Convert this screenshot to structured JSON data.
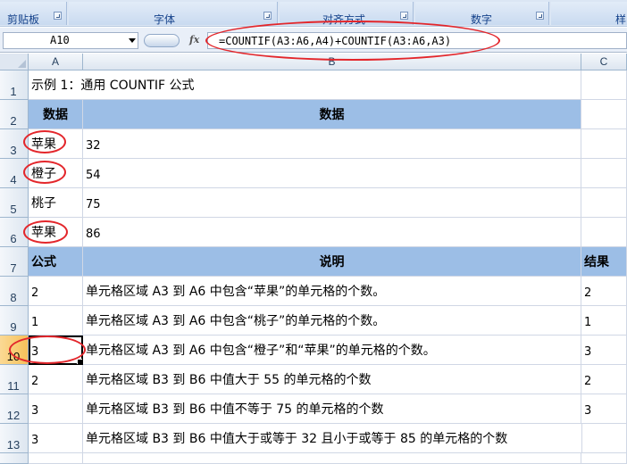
{
  "ribbon": {
    "groups": [
      {
        "label": "剪贴板"
      },
      {
        "label": "字体"
      },
      {
        "label": "对齐方式"
      },
      {
        "label": "数字"
      },
      {
        "label": "样"
      }
    ]
  },
  "formula_bar": {
    "name_box": "A10",
    "fx_label": "fx",
    "formula": "=COUNTIF(A3:A6,A4)+COUNTIF(A3:A6,A3)"
  },
  "columns": [
    "A",
    "B",
    "C"
  ],
  "rows": [
    {
      "num": "1",
      "a": "示例 1：通用 COUNTIF 公式",
      "b": "",
      "c": ""
    },
    {
      "num": "2",
      "a": "数据",
      "b": "数据",
      "c": ""
    },
    {
      "num": "3",
      "a": "苹果",
      "b": "32",
      "c": ""
    },
    {
      "num": "4",
      "a": "橙子",
      "b": "54",
      "c": ""
    },
    {
      "num": "5",
      "a": "桃子",
      "b": "75",
      "c": ""
    },
    {
      "num": "6",
      "a": "苹果",
      "b": "86",
      "c": ""
    },
    {
      "num": "7",
      "a": "公式",
      "b": "说明",
      "c": "结果"
    },
    {
      "num": "8",
      "a": "2",
      "b": "单元格区域 A3 到 A6 中包含“苹果”的单元格的个数。",
      "c": "2"
    },
    {
      "num": "9",
      "a": "1",
      "b": "单元格区域 A3 到 A6 中包含“桃子”的单元格的个数。",
      "c": "1"
    },
    {
      "num": "10",
      "a": "3",
      "b": "单元格区域 A3 到 A6 中包含“橙子”和“苹果”的单元格的个数。",
      "c": "3"
    },
    {
      "num": "11",
      "a": "2",
      "b": "单元格区域 B3 到 B6 中值大于 55 的单元格的个数",
      "c": "2"
    },
    {
      "num": "12",
      "a": "3",
      "b": "单元格区域 B3 到 B6 中值不等于 75 的单元格的个数",
      "c": "3"
    },
    {
      "num": "13",
      "a": "3",
      "b": "单元格区域 B3 到 B6 中值大于或等于 32 且小于或等于 85 的单元格的个数",
      "c": ""
    }
  ],
  "selected_cell": "A10",
  "colors": {
    "header_fill": "#9cbee6",
    "annotation_red": "#e3262b",
    "selected_row_header": "#f5c15a"
  }
}
